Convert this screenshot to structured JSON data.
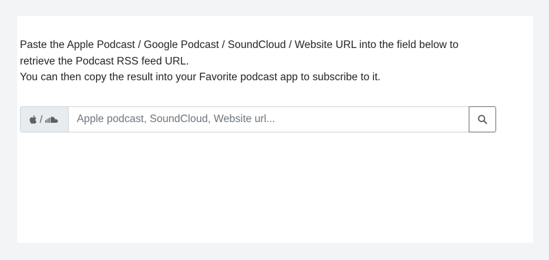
{
  "intro": {
    "line1": "Paste the Apple Podcast / Google Podcast / SoundCloud / Website URL into the field below to retrieve the Podcast RSS feed URL.",
    "line2": "You can then copy the result into your Favorite podcast app to subscribe to it."
  },
  "search": {
    "prefix_separator": "/",
    "prefix_icons": [
      "apple-icon",
      "soundcloud-icon"
    ],
    "value": "",
    "placeholder": "Apple podcast, SoundCloud, Website url...",
    "button_icon": "search-icon"
  },
  "colors": {
    "page_background": "#f3f4f6",
    "card_background": "#ffffff",
    "prefix_background": "#e9ecef",
    "border": "#ced4da",
    "button_border": "#6c757d"
  }
}
